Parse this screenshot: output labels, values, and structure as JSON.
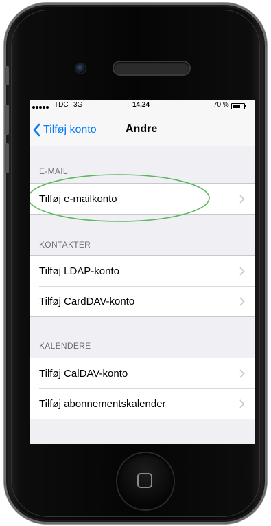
{
  "status_bar": {
    "carrier": "TDC",
    "network": "3G",
    "time": "14.24",
    "battery": "70 %"
  },
  "nav": {
    "back_label": "Tilføj konto",
    "title": "Andre"
  },
  "sections": [
    {
      "header": "E-MAIL",
      "items": [
        {
          "label": "Tilføj e-mailkonto"
        }
      ]
    },
    {
      "header": "KONTAKTER",
      "items": [
        {
          "label": "Tilføj LDAP-konto"
        },
        {
          "label": "Tilføj CardDAV-konto"
        }
      ]
    },
    {
      "header": "KALENDERE",
      "items": [
        {
          "label": "Tilføj CalDAV-konto"
        },
        {
          "label": "Tilføj abonnementskalender"
        }
      ]
    }
  ],
  "colors": {
    "accent": "#007aff",
    "highlight_ellipse": "#5cb85c"
  },
  "icons": {
    "back": "chevron-left-icon",
    "disclosure": "chevron-right-icon",
    "home": "home-button-icon"
  }
}
